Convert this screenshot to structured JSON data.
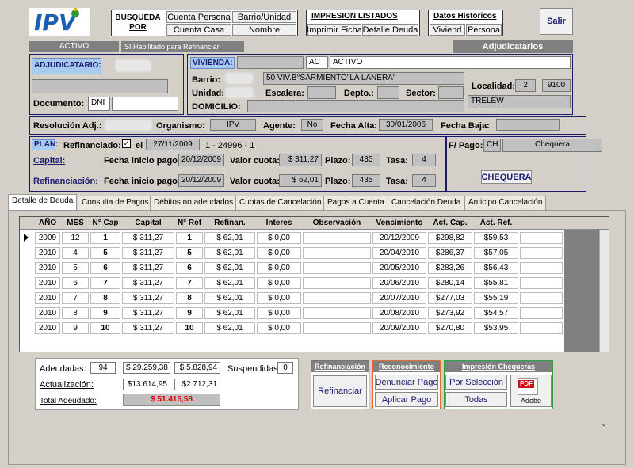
{
  "logo": "IPV",
  "nav": {
    "busqueda": "BUSQUEDA POR",
    "cuenta_persona": "Cuenta Persona",
    "cuenta_casa": "Cuenta Casa",
    "barrio_unidad": "Barrio/Unidad",
    "nombre": "Nombre",
    "impresion_title": "IMPRESION LISTADOS",
    "imprimir_ficha": "Imprimir Ficha",
    "detalle_deuda": "Detalle Deuda",
    "historicos_title": "Datos Históricos",
    "viviend": "Viviend",
    "persona": "Persona",
    "salir": "Salir"
  },
  "status": {
    "activo": "ACTIVO",
    "habilitado": "SI Habilitado para Refinanciar",
    "section": "Adjudicatarios"
  },
  "adjudicatario": {
    "label": "ADJUDICATARIO:",
    "documento_label": "Documento:",
    "doc_type": "DNI"
  },
  "vivienda": {
    "label": "VIVIENDA:",
    "code": "AC",
    "estado": "ACTIVO",
    "barrio_label": "Barrio:",
    "barrio": "50 VIV.B°SARMIENTO\"LA LANERA\"",
    "unidad_label": "Unidad:",
    "escalera_label": "Escalera:",
    "depto_label": "Depto.:",
    "sector_label": "Sector:",
    "domicilio_label": "DOMICILIO:",
    "localidad_label": "Localidad:",
    "localidad_num": "2",
    "cp": "9100",
    "ciudad": "TRELEW"
  },
  "resolucion": {
    "res_label": "Resolución Adj.:",
    "org_label": "Organismo:",
    "organismo": "IPV",
    "agente_label": "Agente:",
    "agente": "No",
    "alta_label": "Fecha Alta:",
    "fecha_alta": "30/01/2006",
    "baja_label": "Fecha Baja:"
  },
  "plan": {
    "label": "PLAN:",
    "refinanciado_label": "Refinanciado:",
    "el": "el",
    "fecha": "27/11/2009",
    "detalle": "1 - 24996 - 1",
    "fpago_label": "F/ Pago:",
    "fpago_code": "CH",
    "fpago": "Chequera",
    "chequera_btn": "CHEQUERA",
    "capital_label": "Capital:",
    "refin_label": "Refinanciación:",
    "fecha_inicio_label": "Fecha inicio pago",
    "valor_cuota_label": "Valor cuota:",
    "plazo_label": "Plazo:",
    "tasa_label": "Tasa:",
    "cap_fecha": "20/12/2009",
    "cap_cuota": "$ 311,27",
    "cap_plazo": "435",
    "cap_tasa": "4",
    "ref_fecha": "20/12/2009",
    "ref_cuota": "$ 62,01",
    "ref_plazo": "435",
    "ref_tasa": "4"
  },
  "tabs": [
    "Detalle de Deuda",
    "Consulta de Pagos",
    "Débitos no adeudados",
    "Cuotas de Cancelación",
    "Pagos a Cuenta",
    "Cancelación Deuda",
    "Anticipo Cancelación"
  ],
  "table": {
    "headers": [
      "AÑO",
      "MES",
      "N° Cap",
      "Capital",
      "N° Ref",
      "Refinan.",
      "Interes",
      "Observación",
      "Vencimiento",
      "Act. Cap.",
      "Act. Ref."
    ],
    "rows": [
      [
        "2009",
        "12",
        "1",
        "$ 311,27",
        "1",
        "$ 62,01",
        "$ 0,00",
        "",
        "20/12/2009",
        "$298,82",
        "$59,53"
      ],
      [
        "2010",
        "4",
        "5",
        "$ 311,27",
        "5",
        "$ 62,01",
        "$ 0,00",
        "",
        "20/04/2010",
        "$286,37",
        "$57,05"
      ],
      [
        "2010",
        "5",
        "6",
        "$ 311,27",
        "6",
        "$ 62,01",
        "$ 0,00",
        "",
        "20/05/2010",
        "$283,26",
        "$56,43"
      ],
      [
        "2010",
        "6",
        "7",
        "$ 311,27",
        "7",
        "$ 62,01",
        "$ 0,00",
        "",
        "20/06/2010",
        "$280,14",
        "$55,81"
      ],
      [
        "2010",
        "7",
        "8",
        "$ 311,27",
        "8",
        "$ 62,01",
        "$ 0,00",
        "",
        "20/07/2010",
        "$277,03",
        "$55,19"
      ],
      [
        "2010",
        "8",
        "9",
        "$ 311,27",
        "9",
        "$ 62,01",
        "$ 0,00",
        "",
        "20/08/2010",
        "$273,92",
        "$54,57"
      ],
      [
        "2010",
        "9",
        "10",
        "$ 311,27",
        "10",
        "$ 62,01",
        "$ 0,00",
        "",
        "20/09/2010",
        "$270,80",
        "$53,95"
      ]
    ]
  },
  "summary": {
    "adeudadas_label": "Adeudadas:",
    "adeudadas": "94",
    "adeudado_cap": "$ 29.259,38",
    "adeudado_ref": "$ 5.828,94",
    "suspendidas_label": "Suspendidas:",
    "suspendidas": "0",
    "actualizacion_label": "Actualización:",
    "act_cap": "$13.614,95",
    "act_ref": "$2.712,31",
    "total_label": "Total Adeudado:",
    "total": "$ 51.415,58"
  },
  "actions": {
    "refin_title": "Refinanciación",
    "refinanciar": "Refinanciar",
    "recon_title": "Reconocimiento",
    "denunciar": "Denunciar Pago",
    "aplicar": "Aplicar Pago",
    "impr_title": "Impresión Chequeras",
    "por_seleccion": "Por Selección",
    "todas": "Todas",
    "pdf_label": "Adobe"
  }
}
